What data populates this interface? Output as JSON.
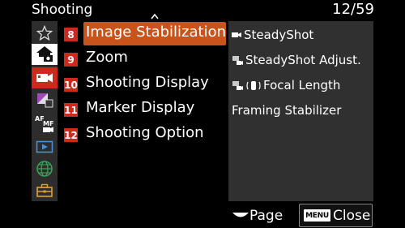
{
  "header": {
    "title": "Shooting",
    "page_counter": "12/59"
  },
  "tabs": [
    {
      "icon": "star-icon"
    },
    {
      "icon": "home-camera-icon"
    },
    {
      "icon": "movie-camera-icon"
    },
    {
      "icon": "edit-icon"
    },
    {
      "icon": "af-mf-icon"
    },
    {
      "icon": "playback-icon"
    },
    {
      "icon": "network-globe-icon"
    },
    {
      "icon": "toolbox-icon"
    }
  ],
  "menu": {
    "items": [
      {
        "number": "8",
        "label": "Image Stabilization"
      },
      {
        "number": "9",
        "label": "Zoom"
      },
      {
        "number": "10",
        "label": "Shooting Display"
      },
      {
        "number": "11",
        "label": "Marker Display"
      },
      {
        "number": "12",
        "label": "Shooting Option"
      }
    ]
  },
  "panel": {
    "rows": [
      {
        "text": "SteadyShot"
      },
      {
        "text": "SteadyShot Adjust."
      },
      {
        "text": "Focal Length"
      },
      {
        "text": "Framing Stabilizer"
      }
    ]
  },
  "bottom": {
    "page_label": "Page",
    "menu_chip": "MENU",
    "close_label": "Close"
  },
  "colors": {
    "highlight": "#c8541c",
    "number_red": "#cc2a1c",
    "panel_bg": "#303030",
    "tab_bg": "#2d2d2d"
  }
}
